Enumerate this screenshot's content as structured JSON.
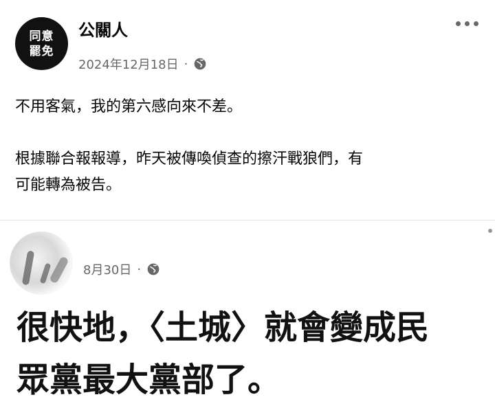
{
  "post": {
    "avatar_lines": [
      "同意",
      "罷免"
    ],
    "author": "公關人",
    "date": "2024年12月18日",
    "separator": "·",
    "privacy_icon": "globe-icon",
    "more_icon": "more-options-icon",
    "paragraphs": [
      "不用客氣，我的第六感向來不差。",
      "根據聯合報報導，昨天被傳喚偵查的擦汗戰狼們，有",
      "可能轉為被告。"
    ]
  },
  "shared_post": {
    "avatar_icon": "blurred-avatar",
    "date": "8月30日",
    "separator": "·",
    "privacy_icon": "globe-icon",
    "text_lines": [
      "很快地，〈土城〉就會變成民",
      "眾黨最大黨部了。"
    ]
  },
  "colors": {
    "text": "#050505",
    "meta": "#65676b",
    "divider": "#e3e3e3"
  }
}
